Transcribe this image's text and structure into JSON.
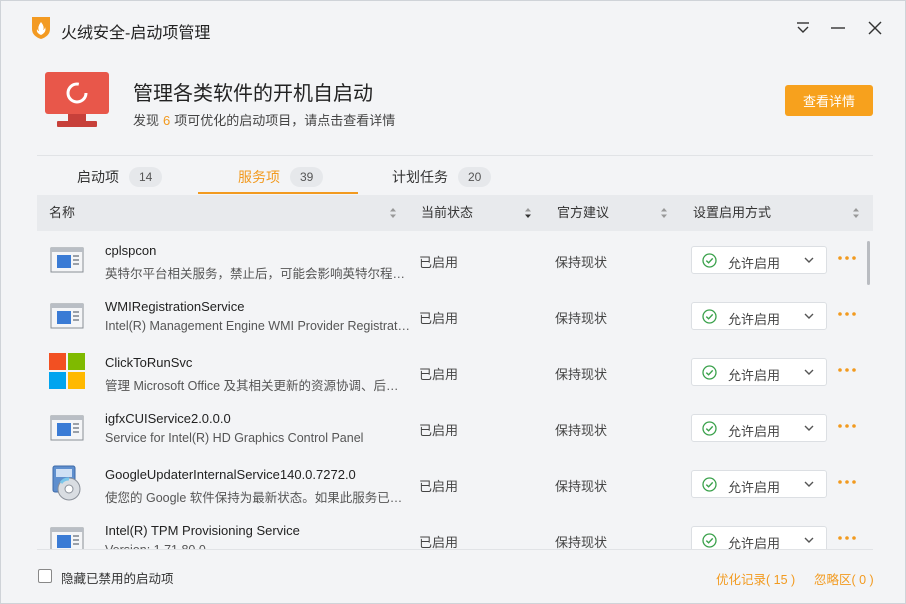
{
  "window": {
    "title": "火绒安全-启动项管理"
  },
  "hero": {
    "title": "管理各类软件的开机自启动",
    "sub_prefix": "发现",
    "sub_count": "6",
    "sub_suffix": "项可优化的启动项目，请点击查看详情",
    "detail_button": "查看详情"
  },
  "tabs": [
    {
      "label": "启动项",
      "count": "14"
    },
    {
      "label": "服务项",
      "count": "39"
    },
    {
      "label": "计划任务",
      "count": "20"
    }
  ],
  "columns": {
    "name": "名称",
    "status": "当前状态",
    "advice": "官方建议",
    "mode": "设置启用方式"
  },
  "rows": [
    {
      "name": "cplspcon",
      "desc": "英特尔平台相关服务，禁止后，可能会影响英特尔程序正常运行",
      "status": "已启用",
      "advice": "保持现状",
      "mode": "允许启用",
      "icon": "window-app-icon"
    },
    {
      "name": "WMIRegistrationService",
      "desc": "Intel(R) Management Engine WMI Provider Registration",
      "status": "已启用",
      "advice": "保持现状",
      "mode": "允许启用",
      "icon": "window-app-icon"
    },
    {
      "name": "ClickToRunSvc",
      "desc": "管理 Microsoft Office 及其相关更新的资源协调、后台流式处理",
      "status": "已启用",
      "advice": "保持现状",
      "mode": "允许启用",
      "icon": "microsoft-logo-icon"
    },
    {
      "name": "igfxCUIService2.0.0.0",
      "desc": "Service for Intel(R) HD Graphics Control Panel",
      "status": "已启用",
      "advice": "保持现状",
      "mode": "允许启用",
      "icon": "window-app-icon"
    },
    {
      "name": "GoogleUpdaterInternalService140.0.7272.0",
      "desc": "使您的 Google 软件保持为最新状态。如果此服务已停用或停止",
      "status": "已启用",
      "advice": "保持现状",
      "mode": "允许启用",
      "icon": "installer-cd-icon"
    },
    {
      "name": "Intel(R) TPM Provisioning Service",
      "desc": "Version: 1.71.80.0",
      "status": "已启用",
      "advice": "保持现状",
      "mode": "允许启用",
      "icon": "window-app-icon"
    }
  ],
  "footer": {
    "hide_label": "隐藏已禁用的启动项",
    "history_link": "优化记录( 15 )",
    "ignore_link": "忽略区( 0 )"
  },
  "colors": {
    "accent": "#f29a1f",
    "button": "#f7a11d",
    "monitor": "#e8574a",
    "enabled_check": "#3aa14b"
  }
}
